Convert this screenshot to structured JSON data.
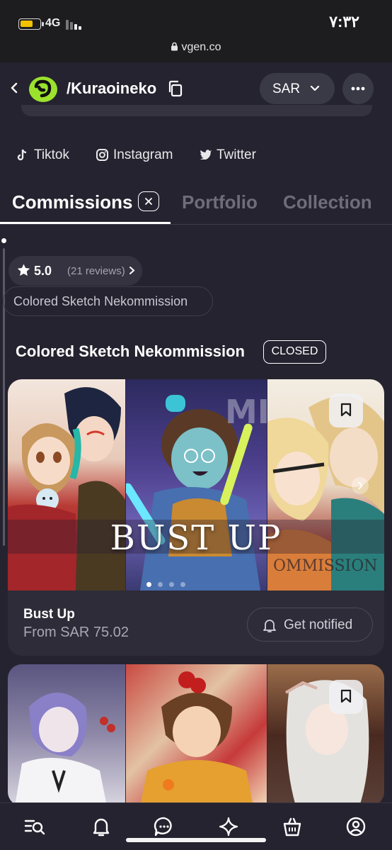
{
  "status_bar": {
    "network": "4G",
    "time": "٧:٣٢",
    "url": "vgen.co"
  },
  "header": {
    "username": "/Kuraoineko",
    "currency": "SAR"
  },
  "social_links": [
    {
      "label": "Tiktok",
      "icon": "tiktok-icon"
    },
    {
      "label": "Instagram",
      "icon": "instagram-icon"
    },
    {
      "label": "Twitter",
      "icon": "twitter-icon"
    }
  ],
  "tabs": [
    {
      "label": "Commissions",
      "active": true
    },
    {
      "label": "Portfolio",
      "active": false
    },
    {
      "label": "Collection",
      "active": false
    }
  ],
  "rating": {
    "score": "5.0",
    "reviews": "(21 reviews)"
  },
  "filter_chip": "Colored Sketch Nekommission",
  "section": {
    "title": "Colored Sketch Nekommission",
    "badge": "CLOSED"
  },
  "cards": [
    {
      "name": "Bust Up",
      "price": "From SAR 75.02",
      "action": "Get notified",
      "overlay_title": "BUST UP",
      "images": [
        "chibi-couple-artwork",
        "glowstick-boy-artwork",
        "blonde-couple-artwork"
      ]
    },
    {
      "images": [
        "purple-hair-artwork",
        "picnic-boy-artwork",
        "white-hair-artwork"
      ]
    }
  ],
  "bottom_nav": [
    "search-icon",
    "bell-icon",
    "chat-icon",
    "sparkle-icon",
    "shop-icon",
    "profile-icon"
  ],
  "colors": {
    "background": "#25232f",
    "card": "#2d2c38",
    "chip": "#34333f",
    "logo_green": "#9be22d",
    "battery": "#f2c200"
  }
}
